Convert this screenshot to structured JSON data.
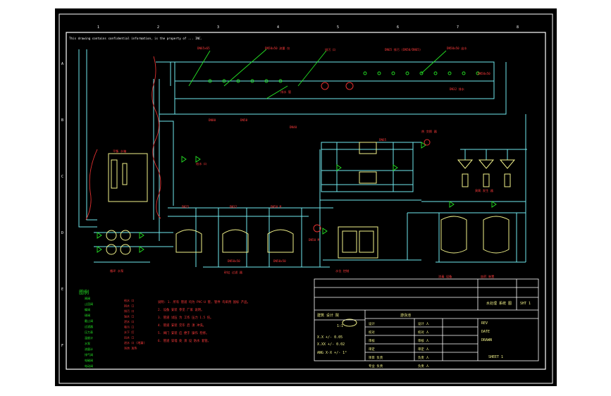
{
  "colors": {
    "background": "#000000",
    "frame": "#ffffff",
    "pipe": "#6fe8ee",
    "equipment": "#f2f28a",
    "leader": "#25e325",
    "label": "#ff3b3b",
    "title_text": "#f2f28a",
    "flow_line": "#e03030"
  },
  "sheet": {
    "notice": "This drawing contains confidential information, is the property of ... INC.",
    "col_numbers": [
      "1",
      "2",
      "3",
      "4",
      "5",
      "6",
      "7",
      "8"
    ],
    "row_letters": [
      "A",
      "B",
      "C",
      "D",
      "E",
      "F"
    ]
  },
  "diagram": {
    "callouts": [
      "DN65x65",
      "DN50x50 流量 仪",
      "排污 口",
      "DN65 排污 (DN50/DN65)",
      "DN50x50 出水",
      "DN50x50",
      "DN80",
      "DN50",
      "DN40",
      "DN65",
      "DN25",
      "DN32",
      "DN50 M",
      "DN50 M",
      "DN50x50",
      "DN50x50",
      "DN32 排水"
    ],
    "labels": [
      "平衡 水箱",
      "循环 水泵",
      "砂缸 过滤 器",
      "热 交换 器",
      "臭氧 发生 器",
      "消毒 设备",
      "加药 装置",
      "水位 控制",
      "排水 管",
      "给水 口"
    ],
    "legend": {
      "title": "图例",
      "items": [
        "闸阀",
        "止回阀",
        "蝶阀",
        "球阀",
        "截止阀",
        "过滤器",
        "压力表",
        "温度计",
        "水泵",
        "流量计",
        "排气阀",
        "电磁阀",
        "电动阀"
      ],
      "items2": [
        "给水 口",
        "回水 口",
        "排污 口",
        "溢水 口",
        "泄水 口",
        "吸污 口",
        "水下 灯",
        "出水 口",
        "进水 口 (地漏)",
        "浴池 加热"
      ]
    },
    "notes": [
      "说明: 1. 所有 管道 均为 PVC-U 管, 管件 均采用 国标 产品。",
      "2. 设备 安装 参见 厂家 说明。",
      "3. 管道 试压 为 工作 压力 1.5 倍。",
      "4. 管道 安装 完毕 后 须 冲洗。",
      "5. 阀门 安装 应 便于 操作 检修。",
      "6. 管道 穿墙 处 须 设 防水 套管。"
    ]
  },
  "title_block": {
    "company": "建筑 设计 院",
    "project": "游泳池",
    "drawing_title": "水处理 系统 图",
    "scale": "1:1",
    "sheet_no": "SHT 1",
    "fields": [
      "设计",
      "校对",
      "审核",
      "审定",
      "项目 负责",
      "专业 负责"
    ],
    "values": [
      "设计 人",
      "校对 人",
      "审核 人",
      "审定 人",
      "负责 人",
      "负责 人"
    ],
    "tolerance1": "X.X    +/- 0.05",
    "tolerance2": "X.XX   +/- 0.02",
    "angle": "ANG  X-X  +/- 1°",
    "rev": "REV",
    "date": "DATE",
    "drawn": "DRAWN",
    "sheet_label": "SHEET 1"
  }
}
